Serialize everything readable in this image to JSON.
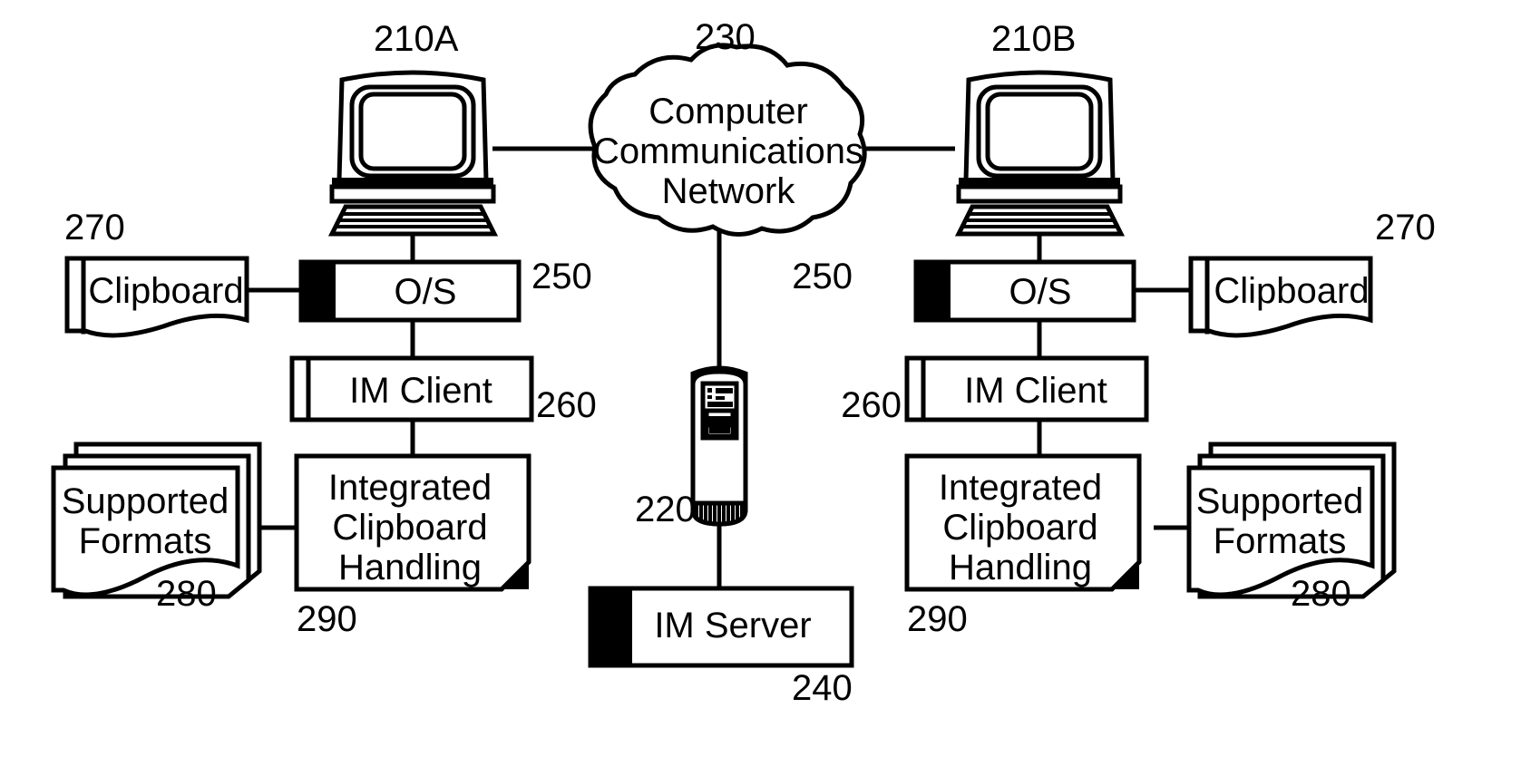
{
  "figure": {
    "type": "patent-diagram",
    "title": "Instant messaging integrated clipboard handling system diagram",
    "background_color": "#ffffff",
    "line_color": "#000000"
  },
  "nodes": {
    "workstation_left": {
      "ref": "210A",
      "icon": "desktop-computer-icon"
    },
    "workstation_right": {
      "ref": "210B",
      "icon": "desktop-computer-icon"
    },
    "network_cloud": {
      "ref": "230",
      "label_line1": "Computer",
      "label_line2": "Communications",
      "label_line3": "Network",
      "icon": "cloud-icon"
    },
    "server_tower": {
      "ref": "220",
      "icon": "server-tower-icon"
    },
    "im_server": {
      "ref": "240",
      "label": "IM Server"
    },
    "os_left": {
      "ref": "250",
      "label": "O/S"
    },
    "os_right": {
      "ref": "250",
      "label": "O/S"
    },
    "im_client_left": {
      "ref": "260",
      "label": "IM Client"
    },
    "im_client_right": {
      "ref": "260",
      "label": "IM Client"
    },
    "clipboard_left": {
      "ref": "270",
      "label": "Clipboard"
    },
    "clipboard_right": {
      "ref": "270",
      "label": "Clipboard"
    },
    "supported_formats_left": {
      "ref": "280",
      "label_line1": "Supported",
      "label_line2": "Formats"
    },
    "supported_formats_right": {
      "ref": "280",
      "label_line1": "Supported",
      "label_line2": "Formats"
    },
    "integrated_clipboard_left": {
      "ref": "290",
      "label_line1": "Integrated",
      "label_line2": "Clipboard",
      "label_line3": "Handling"
    },
    "integrated_clipboard_right": {
      "ref": "290",
      "label_line1": "Integrated",
      "label_line2": "Clipboard",
      "label_line3": "Handling"
    }
  }
}
